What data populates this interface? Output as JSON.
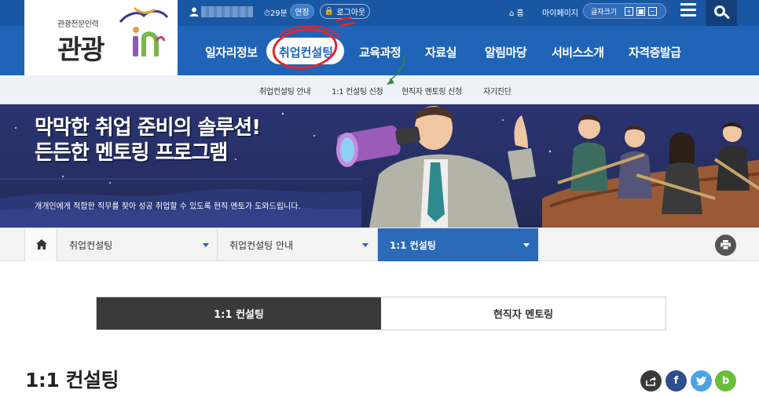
{
  "logo": {
    "subtitle": "관광전문인력",
    "title": "관광"
  },
  "utility": {
    "timer": "29분",
    "extend_label": "연장",
    "logout_label": "로그아웃",
    "home_label": "홈",
    "mypage_label": "마이페이지",
    "font_size_label": "글자크기",
    "font_plus": "+",
    "font_reset": "■",
    "font_minus": "−"
  },
  "gnb": {
    "items": [
      "일자리정보",
      "취업컨설팅",
      "교육과정",
      "자료실",
      "알림마당",
      "서비스소개",
      "자격증발급"
    ],
    "active_index": 1
  },
  "subnav": {
    "items": [
      "취업컨설팅 안내",
      "1:1 컨설팅 신청",
      "현직자 멘토링 신청",
      "자기진단"
    ]
  },
  "banner": {
    "headline_line1": "막막한 취업 준비의 솔루션!",
    "headline_line2": "든든한 멘토링 프로그램",
    "description": "개개인에게 적합한 직무를 찾아 성공 취업할 수 있도록 현직 멘토가 도와드립니다."
  },
  "breadcrumb": {
    "level1": "취업컨설팅",
    "level2": "취업컨설팅 안내",
    "level3": "1:1 컨설팅"
  },
  "tabs": {
    "active": "1:1 컨설팅",
    "inactive": "현직자 멘토링"
  },
  "page": {
    "title": "1:1 컨설팅"
  },
  "share": {
    "facebook": "f",
    "blog": "b"
  },
  "colors": {
    "primary": "#1f64b7",
    "strip": "#1a57a3",
    "breadcrumb_active": "#2b6ab8",
    "tab_active": "#3a3a3a",
    "annotation": "#e3262b"
  }
}
